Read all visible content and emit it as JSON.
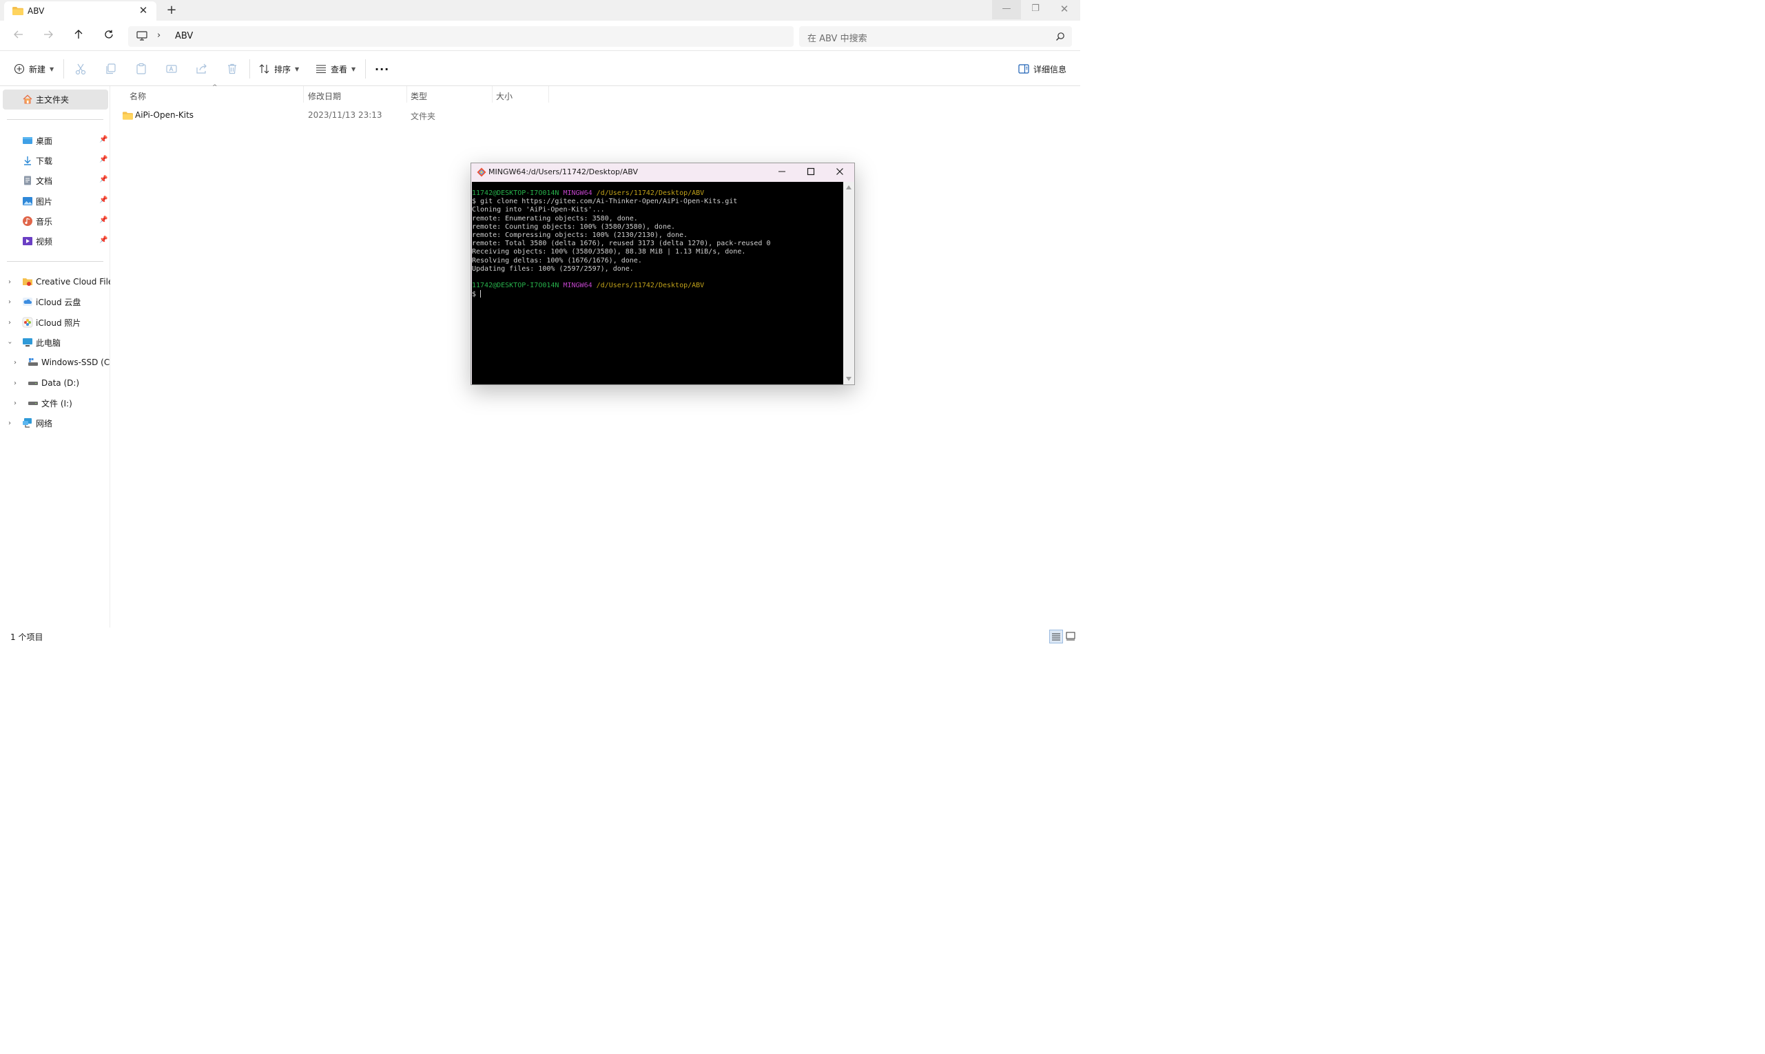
{
  "window": {
    "tab_title": "ABV",
    "new_tab": "+",
    "tab_close": "✕",
    "controls": {
      "minimize": "—",
      "maximize": "❐",
      "close": "✕"
    }
  },
  "address": {
    "breadcrumb_sep": "›",
    "breadcrumb_item": "ABV",
    "search_placeholder": "在 ABV 中搜索"
  },
  "toolbar": {
    "new_label": "新建",
    "sort_label": "排序",
    "view_label": "查看",
    "more_label": "···",
    "details_label": "详细信息"
  },
  "sidebar": {
    "home": "主文件夹",
    "pinned": [
      {
        "label": "桌面",
        "icon": "desktop-icon"
      },
      {
        "label": "下载",
        "icon": "download-icon"
      },
      {
        "label": "文档",
        "icon": "document-icon"
      },
      {
        "label": "图片",
        "icon": "pictures-icon"
      },
      {
        "label": "音乐",
        "icon": "music-icon"
      },
      {
        "label": "视频",
        "icon": "video-icon"
      }
    ],
    "locations": [
      {
        "label": "Creative Cloud Files",
        "icon": "creative-cloud-icon"
      },
      {
        "label": "iCloud 云盘",
        "icon": "icloud-drive-icon"
      },
      {
        "label": "iCloud 照片",
        "icon": "icloud-photos-icon"
      },
      {
        "label": "此电脑",
        "icon": "this-pc-icon"
      },
      {
        "label": "Windows-SSD (C:)",
        "icon": "drive-c-icon"
      },
      {
        "label": "Data (D:)",
        "icon": "drive-d-icon"
      },
      {
        "label": "文件 (I:)",
        "icon": "drive-i-icon"
      },
      {
        "label": "网络",
        "icon": "network-icon"
      }
    ]
  },
  "filelist": {
    "columns": {
      "name": "名称",
      "date": "修改日期",
      "type": "类型",
      "size": "大小"
    },
    "rows": [
      {
        "name": "AiPi-Open-Kits",
        "date": "2023/11/13 23:13",
        "type": "文件夹",
        "size": ""
      }
    ]
  },
  "status": {
    "item_count": "1 个项目"
  },
  "terminal": {
    "title": "MINGW64:/d/Users/11742/Desktop/ABV",
    "prompt_user": "11742@DESKTOP-I7O014N",
    "prompt_env": "MINGW64",
    "prompt_path": "/d/Users/11742/Desktop/ABV",
    "command": "$ git clone https://gitee.com/Ai-Thinker-Open/AiPi-Open-Kits.git",
    "output": [
      "Cloning into 'AiPi-Open-Kits'...",
      "remote: Enumerating objects: 3580, done.",
      "remote: Counting objects: 100% (3580/3580), done.",
      "remote: Compressing objects: 100% (2130/2130), done.",
      "remote: Total 3580 (delta 1676), reused 3173 (delta 1270), pack-reused 0",
      "Receiving objects: 100% (3580/3580), 88.38 MiB | 1.13 MiB/s, done.",
      "Resolving deltas: 100% (1676/1676), done.",
      "Updating files: 100% (2597/2597), done."
    ],
    "prompt_symbol": "$ "
  },
  "colors": {
    "folder": "#f5c04d",
    "accent": "#0067c0",
    "terminal_green": "#27b14b",
    "terminal_magenta": "#bf43c8",
    "terminal_yellow": "#c1a21a"
  }
}
